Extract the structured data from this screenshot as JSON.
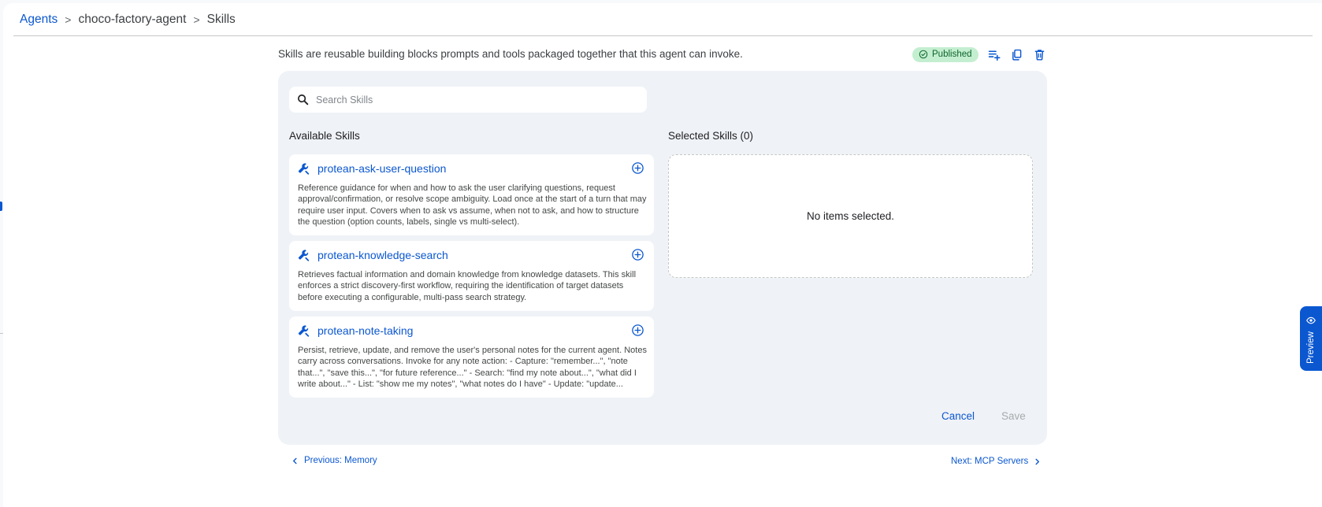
{
  "breadcrumb": {
    "items": [
      "Agents",
      "choco-factory-agent",
      "Skills"
    ],
    "separator": ">"
  },
  "description": "Skills are reusable building blocks prompts and tools packaged together that this agent can invoke.",
  "status": {
    "label": "Published",
    "color": "#c4eed0"
  },
  "toolbar_icons": [
    "playlist-add-icon",
    "copy-icon",
    "delete-icon"
  ],
  "search": {
    "placeholder": "Search Skills",
    "value": ""
  },
  "available": {
    "heading": "Available Skills",
    "items": [
      {
        "name": "protean-ask-user-question",
        "description": "Reference guidance for when and how to ask the user clarifying questions, request approval/confirmation, or resolve scope ambiguity. Load once at the start of a turn that may require user input. Covers when to ask vs assume, when not to ask, and how to structure the question (option counts, labels, single vs multi-select)."
      },
      {
        "name": "protean-knowledge-search",
        "description": "Retrieves factual information and domain knowledge from knowledge datasets. This skill enforces a strict discovery-first workflow, requiring the identification of target datasets before executing a configurable, multi-pass search strategy."
      },
      {
        "name": "protean-note-taking",
        "description": "Persist, retrieve, update, and remove the user's personal notes for the current agent. Notes carry across conversations. Invoke for any note action: - Capture: \"remember...\", \"note that...\", \"save this...\", \"for future reference...\" - Search: \"find my note about...\", \"what did I write about...\" - List: \"show me my notes\", \"what notes do I have\" - Update: \"update..."
      }
    ]
  },
  "selected": {
    "heading": "Selected Skills (0)",
    "empty_text": "No items selected."
  },
  "actions": {
    "cancel": "Cancel",
    "save": "Save"
  },
  "nav": {
    "previous": "Previous: Memory",
    "next": "Next: MCP Servers"
  },
  "preview_tab": {
    "label": "Preview"
  },
  "colors": {
    "accent": "#0b57d0",
    "panel": "#eff2f6",
    "published_bg": "#c4eed0"
  }
}
